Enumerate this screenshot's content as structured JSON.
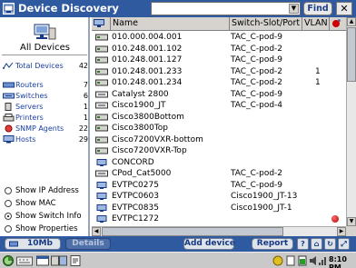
{
  "window": {
    "title": "Device Discovery",
    "find_label": "Find",
    "close_label": "✕",
    "search_value": ""
  },
  "sidebar": {
    "all_devices_label": "All Devices",
    "categories": [
      {
        "label": "Total Devices",
        "count": "42"
      },
      {
        "label": "Routers",
        "count": "7"
      },
      {
        "label": "Switches",
        "count": "6"
      },
      {
        "label": "Servers",
        "count": "1"
      },
      {
        "label": "Printers",
        "count": "1"
      },
      {
        "label": "SNMP Agents",
        "count": "22"
      },
      {
        "label": "Hosts",
        "count": "29"
      }
    ],
    "options": [
      {
        "label": "Show IP Address",
        "selected": false
      },
      {
        "label": "Show MAC",
        "selected": false
      },
      {
        "label": "Show Switch Info",
        "selected": true
      },
      {
        "label": "Show Properties",
        "selected": false
      }
    ]
  },
  "table": {
    "headers": {
      "name": "Name",
      "switch": "Switch-Slot/Port",
      "vlan": "VLAN"
    },
    "rows": [
      {
        "name": "010.000.004.001",
        "switch": "TAC_C-pod-9",
        "vlan": "",
        "icon": "router",
        "flag": false
      },
      {
        "name": "010.248.001.102",
        "switch": "TAC_C-pod-2",
        "vlan": "",
        "icon": "router",
        "flag": false
      },
      {
        "name": "010.248.001.127",
        "switch": "TAC_C-pod-9",
        "vlan": "",
        "icon": "router",
        "flag": false
      },
      {
        "name": "010.248.001.233",
        "switch": "TAC_C-pod-2",
        "vlan": "1",
        "icon": "router",
        "flag": false
      },
      {
        "name": "010.248.001.234",
        "switch": "TAC_C-pod-2",
        "vlan": "1",
        "icon": "router",
        "flag": false
      },
      {
        "name": "Catalyst 2800",
        "switch": "TAC_C-pod-9",
        "vlan": "",
        "icon": "switch",
        "flag": false
      },
      {
        "name": "Cisco1900_JT",
        "switch": "TAC_C-pod-4",
        "vlan": "",
        "icon": "switch",
        "flag": false
      },
      {
        "name": "Cisco3800Bottom",
        "switch": "",
        "vlan": "",
        "icon": "router",
        "flag": false
      },
      {
        "name": "Cisco3800Top",
        "switch": "",
        "vlan": "",
        "icon": "router",
        "flag": false
      },
      {
        "name": "Cisco7200VXR-bottom",
        "switch": "",
        "vlan": "",
        "icon": "router",
        "flag": false
      },
      {
        "name": "Cisco7200VXR-Top",
        "switch": "",
        "vlan": "",
        "icon": "router",
        "flag": false
      },
      {
        "name": "CONCORD",
        "switch": "",
        "vlan": "",
        "icon": "host",
        "flag": false
      },
      {
        "name": "CPod_Cat5000",
        "switch": "TAC_C-pod-2",
        "vlan": "",
        "icon": "switch",
        "flag": false
      },
      {
        "name": "EVTPC0275",
        "switch": "TAC_C-pod-9",
        "vlan": "",
        "icon": "host",
        "flag": false
      },
      {
        "name": "EVTPC0603",
        "switch": "Cisco1900_JT-13",
        "vlan": "",
        "icon": "host",
        "flag": false
      },
      {
        "name": "EVTPC0835",
        "switch": "Cisco1900_JT-1",
        "vlan": "",
        "icon": "host",
        "flag": false
      },
      {
        "name": "EVTPC1272",
        "switch": "",
        "vlan": "",
        "icon": "host",
        "flag": true
      }
    ]
  },
  "toolbar": {
    "speed_label": "10Mb",
    "details_label": "Details",
    "add_device_label": "Add device",
    "report_label": "Report"
  },
  "taskbar": {
    "clock": "8:10 PM"
  },
  "colors": {
    "titlebar": "#2f5aa0",
    "link": "#1a3fa0",
    "flag": "#cc0000"
  }
}
